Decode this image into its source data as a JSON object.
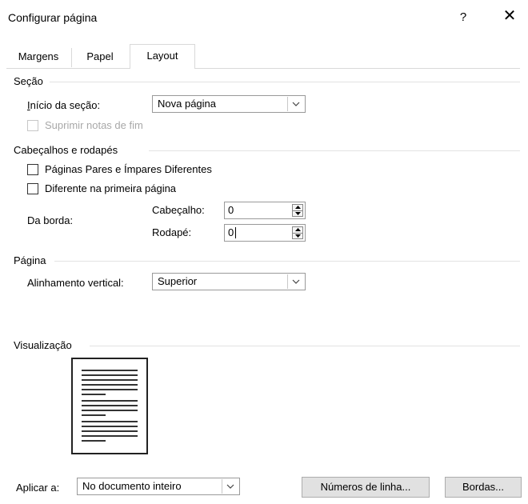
{
  "window": {
    "title": "Configurar página",
    "help": "?",
    "close": "✕"
  },
  "tabs": [
    {
      "label": "Margens",
      "selected": false
    },
    {
      "label": "Papel",
      "selected": false
    },
    {
      "label": "Layout",
      "selected": true
    }
  ],
  "section": {
    "header": "Seção",
    "start_label": "Início da seção:",
    "start_value": "Nova página",
    "suppress_endnotes_label": "Suprimir notas de fim",
    "suppress_endnotes_checked": false
  },
  "headers_footers": {
    "header": "Cabeçalhos e rodapés",
    "odd_even_label": "Páginas Pares e Ímpares Diferentes",
    "odd_even_checked": false,
    "first_page_label": "Diferente na primeira página",
    "first_page_checked": false,
    "from_edge_label": "Da borda:",
    "header_label": "Cabeçalho:",
    "header_value": "0",
    "footer_label": "Rodapé:",
    "footer_value": "0"
  },
  "page": {
    "header": "Página",
    "vertical_alignment_label": "Alinhamento vertical:",
    "vertical_alignment_value": "Superior"
  },
  "preview": {
    "header": "Visualização"
  },
  "footer": {
    "apply_to_label": "Aplicar a:",
    "apply_to_value": "No documento inteiro",
    "line_numbers_button": "Números de linha...",
    "borders_button": "Bordas..."
  },
  "icons": {
    "dropdown": "chevron-down-icon",
    "spin": "spin-up-down-icon",
    "close": "close-icon"
  }
}
